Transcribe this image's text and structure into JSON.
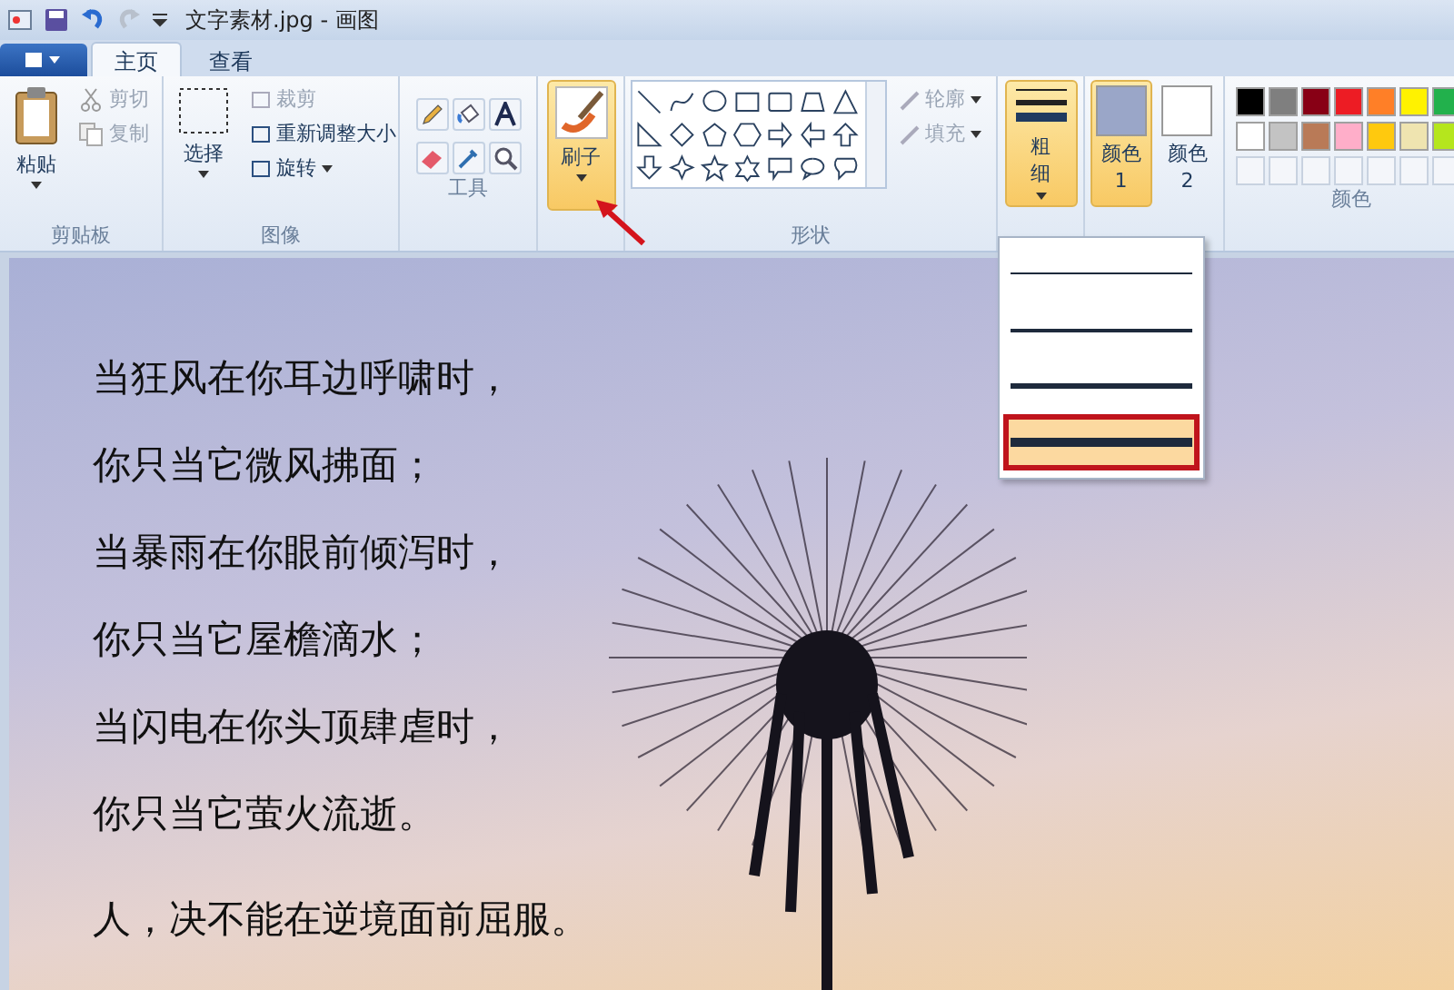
{
  "window": {
    "title": "文字素材.jpg - 画图"
  },
  "tabs": [
    {
      "label": "主页",
      "selected": true
    },
    {
      "label": "查看",
      "selected": false
    }
  ],
  "clipboard": {
    "label": "剪贴板",
    "paste": "粘贴",
    "cut": {
      "label": "剪切",
      "disabled": true
    },
    "copy": {
      "label": "复制",
      "disabled": true
    }
  },
  "image": {
    "label": "图像",
    "select": "选择",
    "crop": {
      "label": "裁剪",
      "disabled": true
    },
    "resize": {
      "label": "重新调整大小",
      "disabled": false
    },
    "rotate": {
      "label": "旋转",
      "disabled": false
    }
  },
  "tools": {
    "label": "工具"
  },
  "brushes": {
    "label": "刷子",
    "selected": true
  },
  "shapes": {
    "label": "形状",
    "outline": {
      "label": "轮廓",
      "disabled": true
    },
    "fill": {
      "label": "填充",
      "disabled": true
    }
  },
  "size": {
    "label": "粗细",
    "selected": true,
    "options": [
      {
        "selected": false
      },
      {
        "selected": false
      },
      {
        "selected": false
      },
      {
        "selected": true
      }
    ]
  },
  "color1": {
    "label": "颜色 1",
    "selected": true,
    "color": "#9aa6c8"
  },
  "color2": {
    "label": "颜色 2",
    "selected": false,
    "color": "#ffffff"
  },
  "colors": {
    "label": "颜色",
    "palette": [
      {
        "color": "#000000"
      },
      {
        "color": "#7f7f7f"
      },
      {
        "color": "#880015"
      },
      {
        "color": "#ed1c24"
      },
      {
        "color": "#ff7f27"
      },
      {
        "color": "#fff200"
      },
      {
        "color": "#22b14c"
      },
      {
        "color": "#ffffff"
      },
      {
        "color": "#c3c3c3"
      },
      {
        "color": "#b97a57"
      },
      {
        "color": "#ffaec9"
      },
      {
        "color": "#ffc90e"
      },
      {
        "color": "#efe4b0"
      },
      {
        "color": "#b5e61d"
      }
    ]
  },
  "canvas": {
    "poem": [
      "当狂风在你耳边呼啸时，",
      "你只当它微风拂面；",
      "当暴雨在你眼前倾泻时，",
      "你只当它屋檐滴水；",
      "当闪电在你头顶肆虐时，",
      "你只当它萤火流逝。",
      "人，决不能在逆境面前屈服。"
    ]
  }
}
